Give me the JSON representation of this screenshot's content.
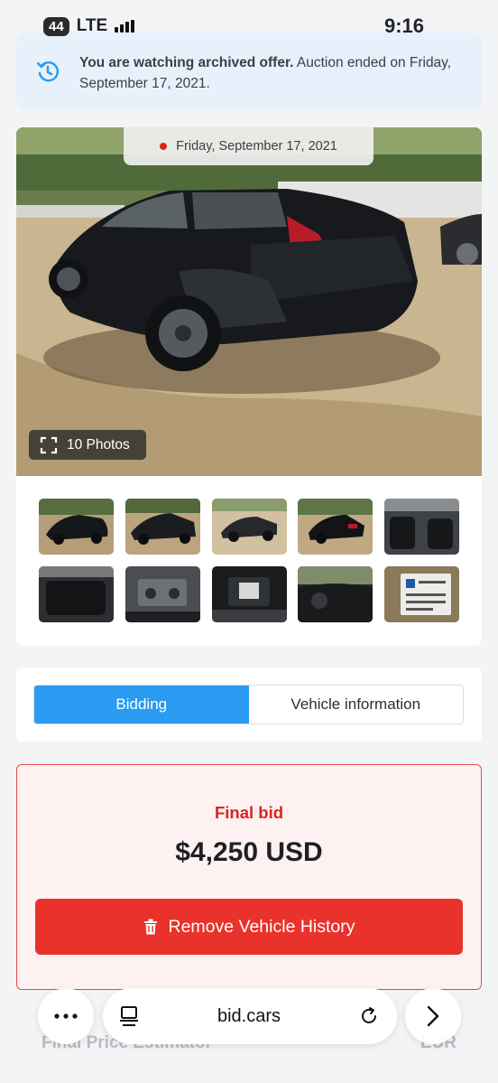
{
  "status_bar": {
    "battery": "44",
    "network": "LTE",
    "time": "9:16"
  },
  "archive_banner": {
    "bold_text": "You are watching archived offer.",
    "text": " Auction ended on Friday, September 17, 2021."
  },
  "gallery": {
    "date_chip": "Friday, September 17, 2021",
    "photos_count_label": "10 Photos",
    "thumbnails": [
      "exterior-front-left",
      "exterior-front-right",
      "exterior-rear-left",
      "exterior-rear-right",
      "interior-front-seats",
      "interior-rear-seats",
      "engine-bay",
      "instrument-cluster",
      "dashboard",
      "vin-label"
    ]
  },
  "tabs": {
    "items": [
      "Bidding",
      "Vehicle information"
    ],
    "active": "Bidding"
  },
  "final_bid": {
    "label": "Final bid",
    "amount": "$4,250 USD",
    "button_label": "Remove Vehicle History"
  },
  "under_content": {
    "left": "Final Price Estimator",
    "right": "EUR"
  },
  "browser": {
    "url": "bid.cars"
  },
  "colors": {
    "accent_blue": "#2a9bf0",
    "danger_red": "#e8322b",
    "banner_bg": "#e6f1fb"
  }
}
